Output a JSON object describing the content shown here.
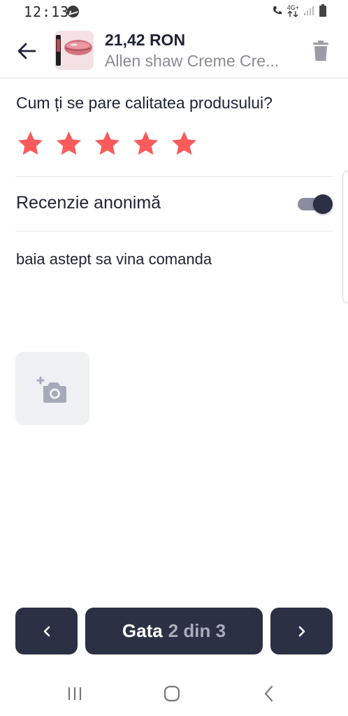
{
  "status_bar": {
    "time": "12:13",
    "network": "4G+"
  },
  "header": {
    "price": "21,42 RON",
    "product_name": "Allen shaw Creme Cre..."
  },
  "rating": {
    "question": "Cum ți se pare calitatea produsului?",
    "value": 5,
    "max": 5,
    "star_color": "#fb5b5b"
  },
  "anonymous": {
    "label": "Recenzie anonimă",
    "enabled": true
  },
  "review": {
    "text": "baia astept sa vina comanda"
  },
  "footer": {
    "done_label": "Gata",
    "pager": "2 din 3",
    "accent": "#2b3045"
  },
  "icons": {
    "back": "arrow-left-icon",
    "trash": "trash-icon",
    "photo": "add-photo-icon",
    "prev": "chevron-left-icon",
    "next": "chevron-right-icon"
  }
}
